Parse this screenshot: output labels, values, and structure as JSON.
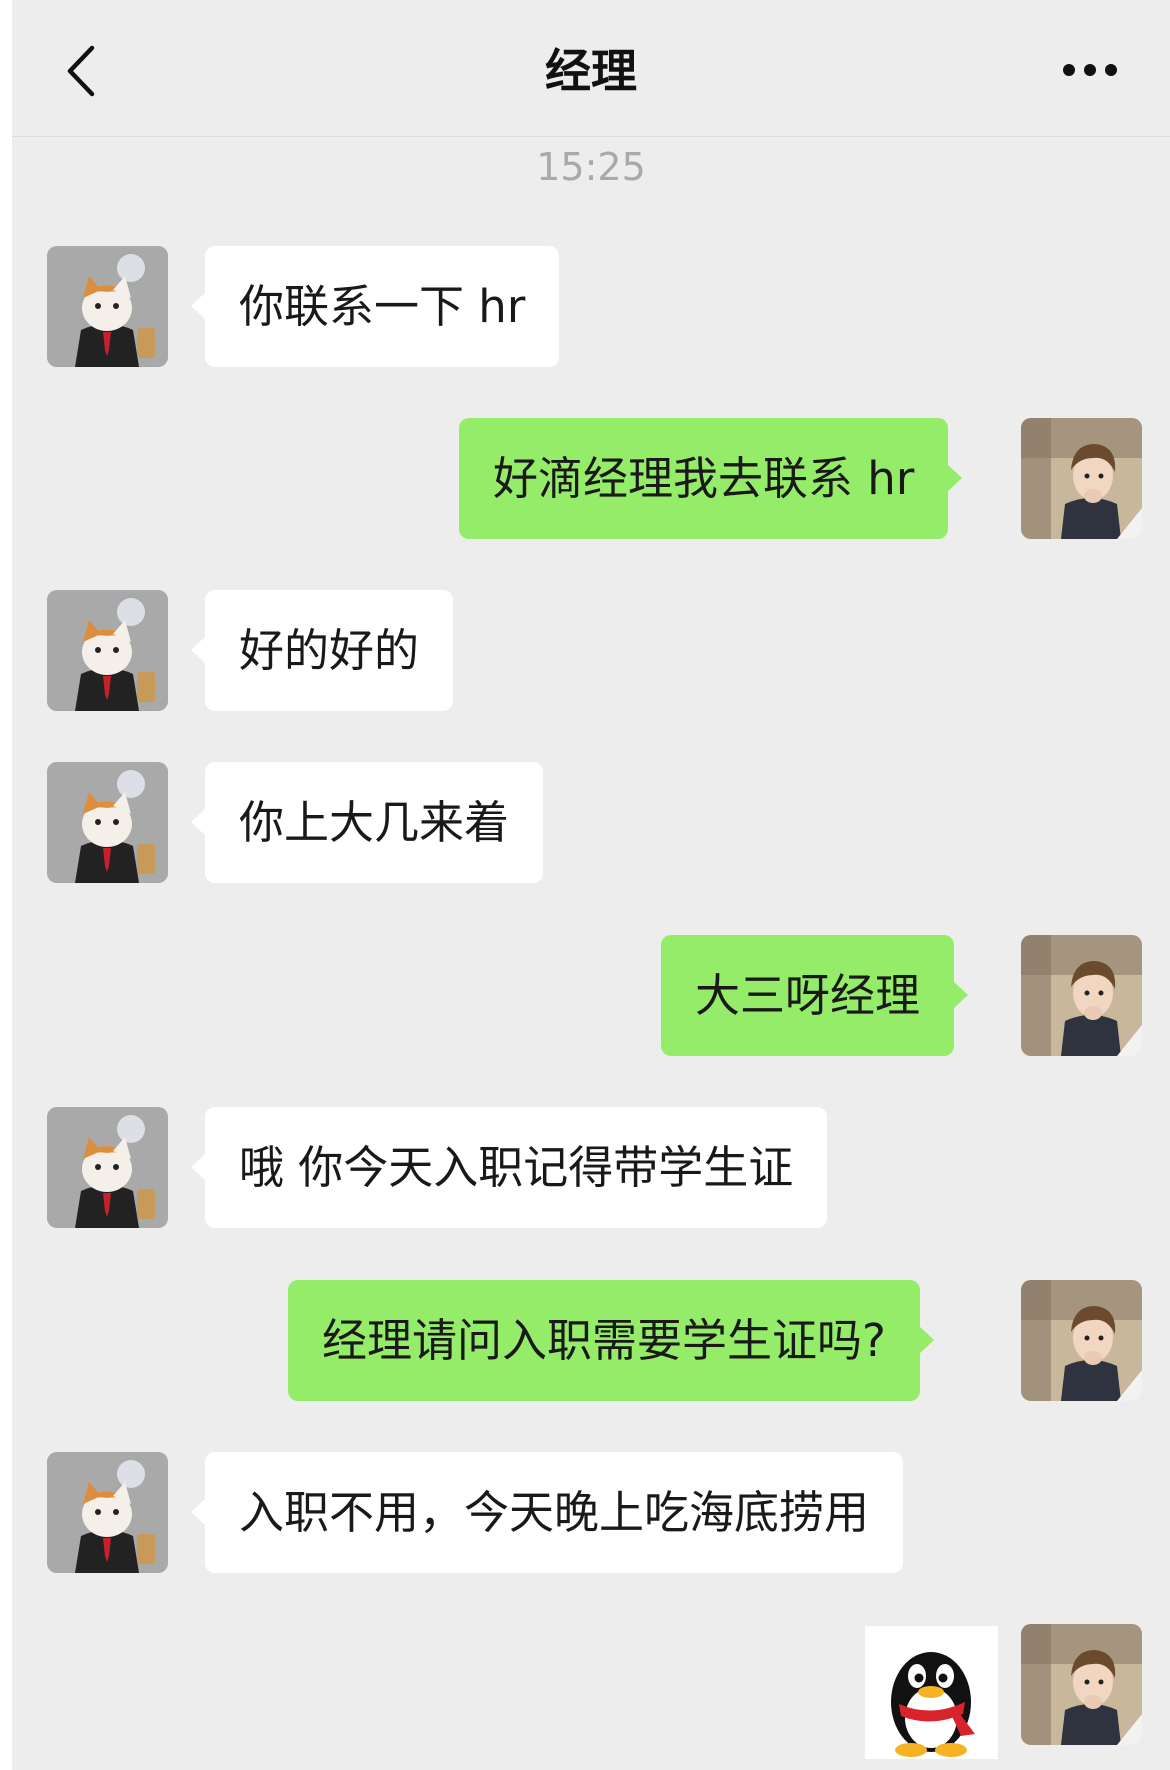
{
  "header": {
    "title": "经理"
  },
  "timestamp": "15:25",
  "messages": [
    {
      "side": "left",
      "text": "你联系一下 hr"
    },
    {
      "side": "right",
      "text": "好滴经理我去联系 hr"
    },
    {
      "side": "left",
      "text": "好的好的"
    },
    {
      "side": "left",
      "text": "你上大几来着"
    },
    {
      "side": "right",
      "text": "大三呀经理"
    },
    {
      "side": "left",
      "text": "哦 你今天入职记得带学生证"
    },
    {
      "side": "right",
      "text": "经理请问入职需要学生证吗?"
    },
    {
      "side": "left",
      "text": "入职不用，今天晚上吃海底捞用"
    },
    {
      "side": "right",
      "type": "sticker",
      "sticker": "qq-penguin"
    }
  ],
  "colors": {
    "background": "#ededed",
    "bubble_self": "#95ec69",
    "bubble_other": "#ffffff"
  },
  "icons": {
    "back": "chevron-left-icon",
    "more": "more-dots-icon"
  }
}
